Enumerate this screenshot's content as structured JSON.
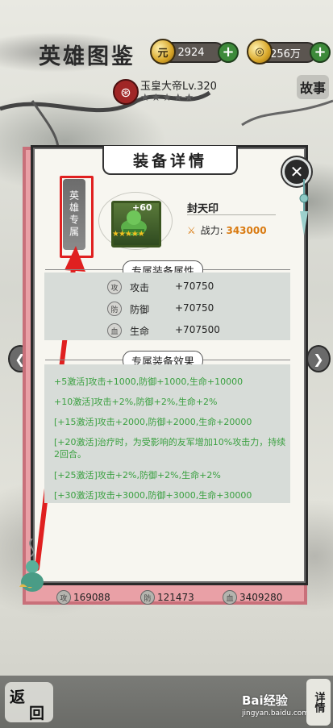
{
  "header": {
    "title": "英雄图鉴",
    "gold": "2924",
    "coins": "256万"
  },
  "hero": {
    "name": "玉皇大帝Lv.320",
    "stars": "★★★★★",
    "story_label": "故事"
  },
  "modal": {
    "title": "装备详情",
    "side_tab": "英雄专属",
    "item": {
      "name": "封天印",
      "plus": "+60",
      "stars": "★★★★★",
      "power_label": "战力:",
      "power_value": "343000"
    },
    "attr_section": "专属装备属性",
    "attrs": [
      {
        "icon": "攻",
        "label": "攻击",
        "value": "+70750"
      },
      {
        "icon": "防",
        "label": "防御",
        "value": "+70750"
      },
      {
        "icon": "血",
        "label": "生命",
        "value": "+707500"
      }
    ],
    "effect_section": "专属装备效果",
    "effects": [
      "+5激活]攻击+1000,防御+1000,生命+10000",
      "+10激活]攻击+2%,防御+2%,生命+2%",
      "[+15激活]攻击+2000,防御+2000,生命+20000",
      "[+20激活]治疗时，为受影响的友军增加10%攻击力，持续2回合。",
      "[+25激活]攻击+2%,防御+2%,生命+2%",
      "[+30激活]攻击+3000,防御+3000,生命+30000"
    ]
  },
  "bottom_stats": [
    {
      "icon": "攻",
      "value": "169088"
    },
    {
      "icon": "防",
      "value": "121473"
    },
    {
      "icon": "血",
      "value": "3409280"
    }
  ],
  "footer": {
    "back_1": "返",
    "back_2": "回",
    "detail": "详情",
    "watermark": "Bai经验",
    "watermark_sub": "jingyan.baidu.com"
  },
  "colors": {
    "effect_text": "#3aa040",
    "power_value": "#d97a10",
    "highlight": "#e02020"
  }
}
